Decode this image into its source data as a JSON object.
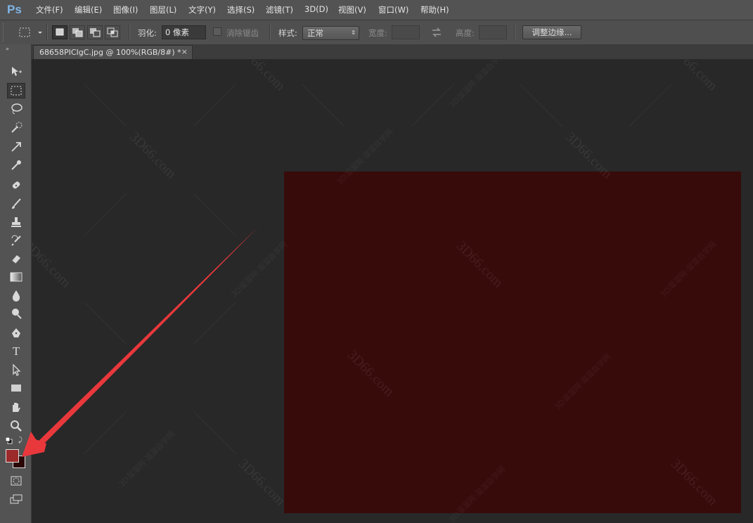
{
  "app": {
    "logo": "Ps"
  },
  "menu": [
    {
      "id": "file",
      "label": "文件(F)"
    },
    {
      "id": "edit",
      "label": "编辑(E)"
    },
    {
      "id": "image",
      "label": "图像(I)"
    },
    {
      "id": "layer",
      "label": "图层(L)"
    },
    {
      "id": "type",
      "label": "文字(Y)"
    },
    {
      "id": "select",
      "label": "选择(S)"
    },
    {
      "id": "filter",
      "label": "滤镜(T)"
    },
    {
      "id": "3d",
      "label": "3D(D)"
    },
    {
      "id": "view",
      "label": "视图(V)"
    },
    {
      "id": "window",
      "label": "窗口(W)"
    },
    {
      "id": "help",
      "label": "帮助(H)"
    }
  ],
  "options": {
    "feather_label": "羽化:",
    "feather_value": "0 像素",
    "antialias_label": "消除锯齿",
    "style_label": "样式:",
    "style_value": "正常",
    "width_label": "宽度:",
    "height_label": "高度:",
    "refine_edge_label": "调整边缘..."
  },
  "document": {
    "tab_title": "68658PICIgC.jpg @ 100%(RGB/8#) *",
    "close_glyph": "×",
    "fill_color": "#380b0b"
  },
  "colors": {
    "foreground": "#9c2a2a",
    "background": "#2a0606",
    "arrow": "#e8383c"
  },
  "watermark": {
    "text": "3D66.com",
    "subtext": "3D溜溜网·溜溜自学网"
  },
  "tools": [
    {
      "id": "move",
      "icon": "move-icon"
    },
    {
      "id": "marquee",
      "icon": "rect-marquee-icon",
      "active": true
    },
    {
      "id": "lasso",
      "icon": "lasso-icon"
    },
    {
      "id": "quick-select",
      "icon": "quick-select-icon"
    },
    {
      "id": "crop",
      "icon": "crop-icon"
    },
    {
      "id": "eyedropper",
      "icon": "eyedropper-icon"
    },
    {
      "id": "healing",
      "icon": "healing-brush-icon"
    },
    {
      "id": "brush",
      "icon": "brush-icon"
    },
    {
      "id": "stamp",
      "icon": "clone-stamp-icon"
    },
    {
      "id": "history-brush",
      "icon": "history-brush-icon"
    },
    {
      "id": "eraser",
      "icon": "eraser-icon"
    },
    {
      "id": "gradient",
      "icon": "gradient-icon"
    },
    {
      "id": "blur",
      "icon": "blur-icon"
    },
    {
      "id": "dodge",
      "icon": "dodge-icon"
    },
    {
      "id": "pen",
      "icon": "pen-icon"
    },
    {
      "id": "type",
      "icon": "type-icon",
      "glyph": "T"
    },
    {
      "id": "path-select",
      "icon": "path-select-icon"
    },
    {
      "id": "shape",
      "icon": "rectangle-shape-icon"
    },
    {
      "id": "hand",
      "icon": "hand-icon"
    },
    {
      "id": "zoom",
      "icon": "zoom-icon"
    }
  ]
}
